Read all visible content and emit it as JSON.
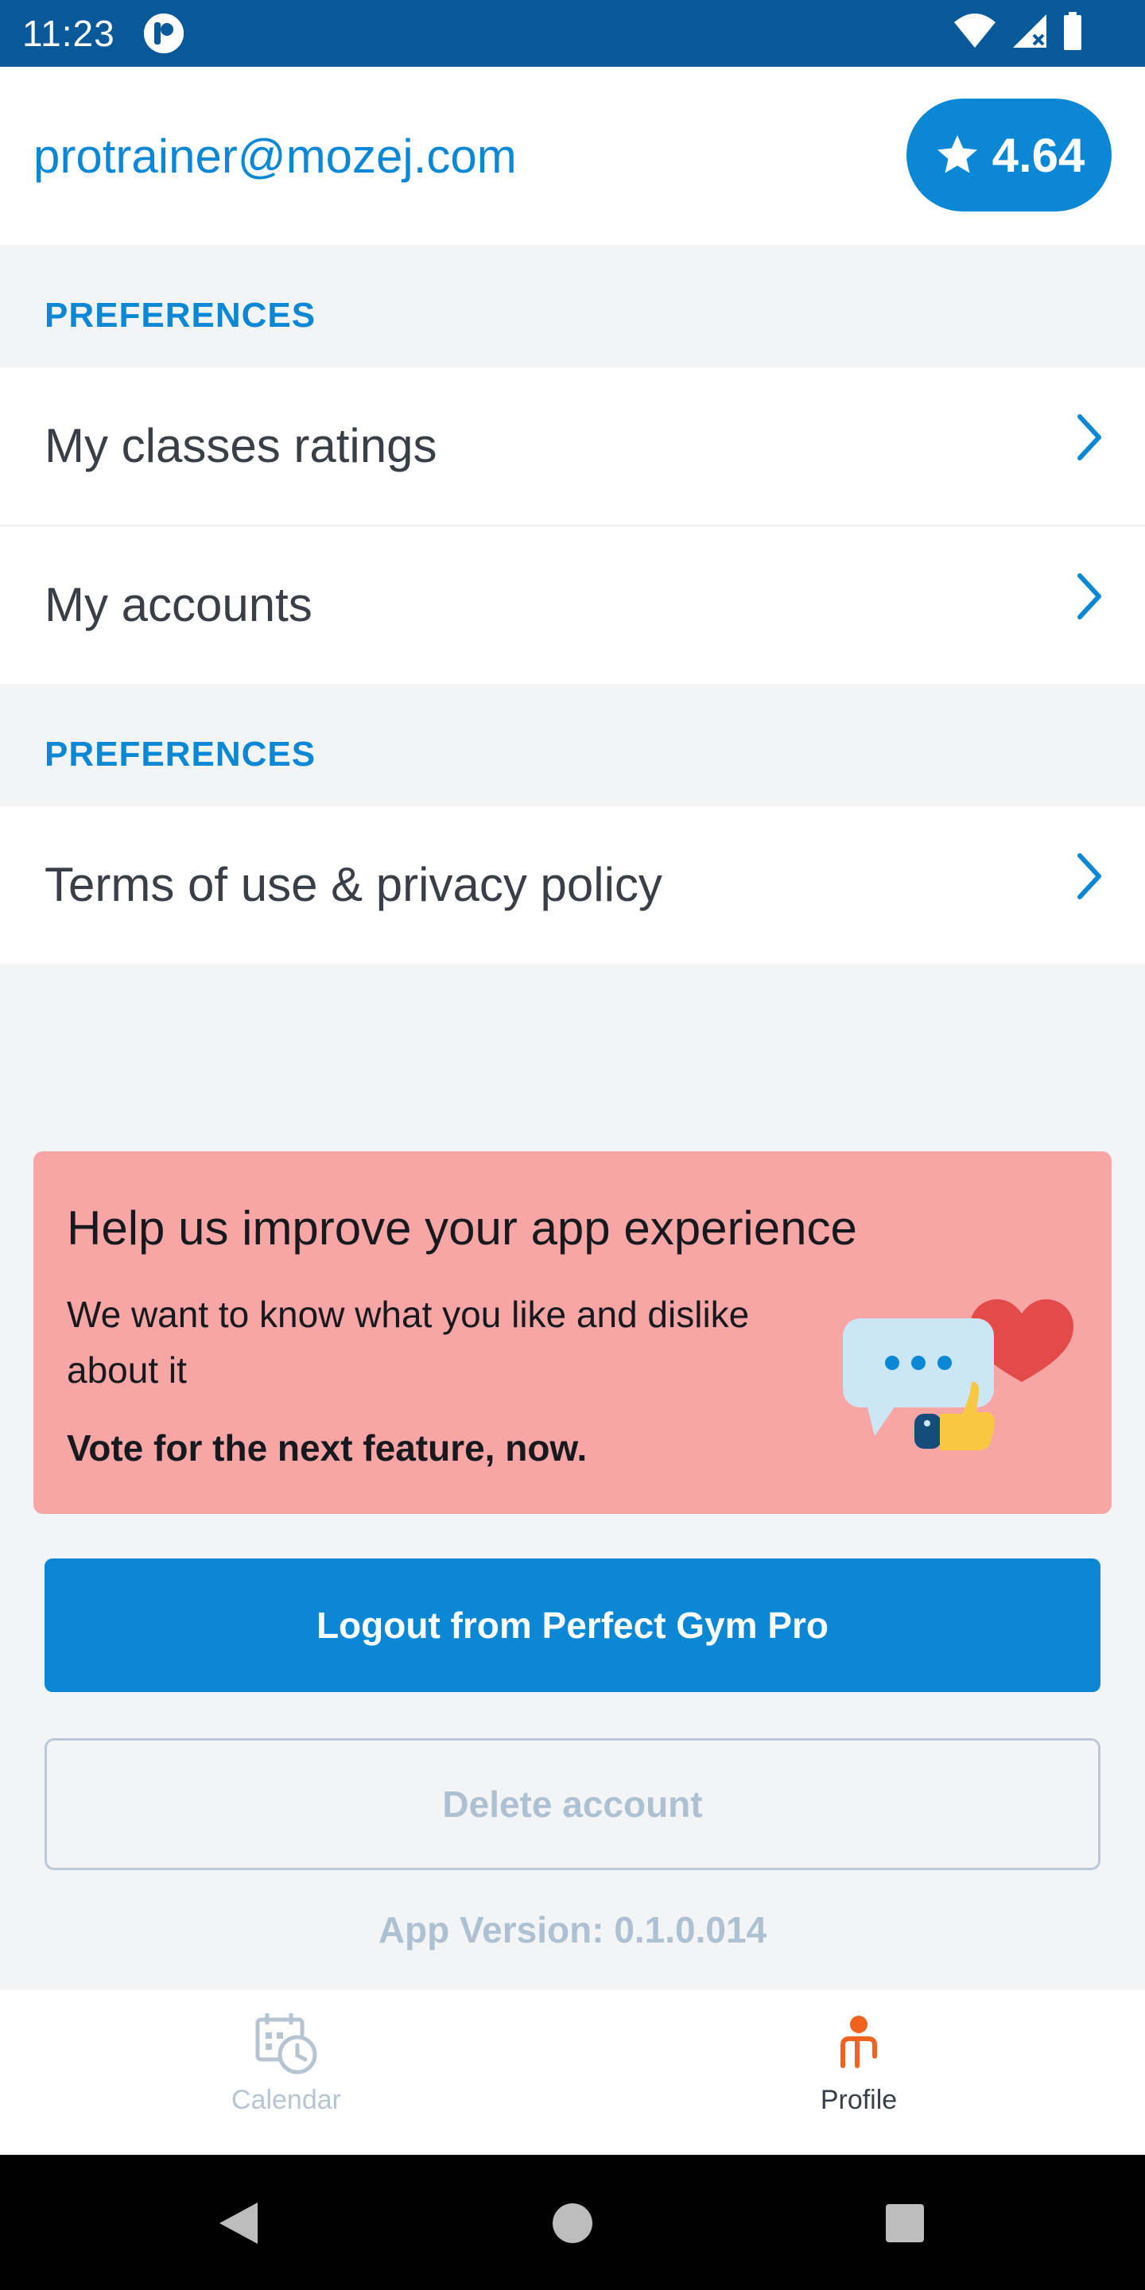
{
  "status_bar": {
    "time": "11:23"
  },
  "header": {
    "email": "protrainer@mozej.com",
    "rating": "4.64"
  },
  "sections": [
    {
      "label": "PREFERENCES",
      "items": [
        {
          "label": "My classes ratings"
        },
        {
          "label": "My accounts"
        }
      ]
    },
    {
      "label": "PREFERENCES",
      "items": [
        {
          "label": "Terms of use & privacy policy"
        }
      ]
    }
  ],
  "feedback": {
    "title": "Help us improve your app experience",
    "text": "We want to know what you like and dislike about it",
    "cta": "Vote for the next feature, now."
  },
  "actions": {
    "logout_label": "Logout from Perfect Gym Pro",
    "delete_label": "Delete account"
  },
  "app_version": "App Version: 0.1.0.014",
  "bottom_nav": {
    "items": [
      {
        "label": "Calendar",
        "icon": "calendar-clock-icon",
        "active": false
      },
      {
        "label": "Profile",
        "icon": "profile-person-icon",
        "active": true
      }
    ]
  },
  "colors": {
    "accent": "#0a88d6",
    "status_bar": "#07599a",
    "feedback_bg": "#f8a5a5",
    "active_nav": "#f2621f"
  }
}
